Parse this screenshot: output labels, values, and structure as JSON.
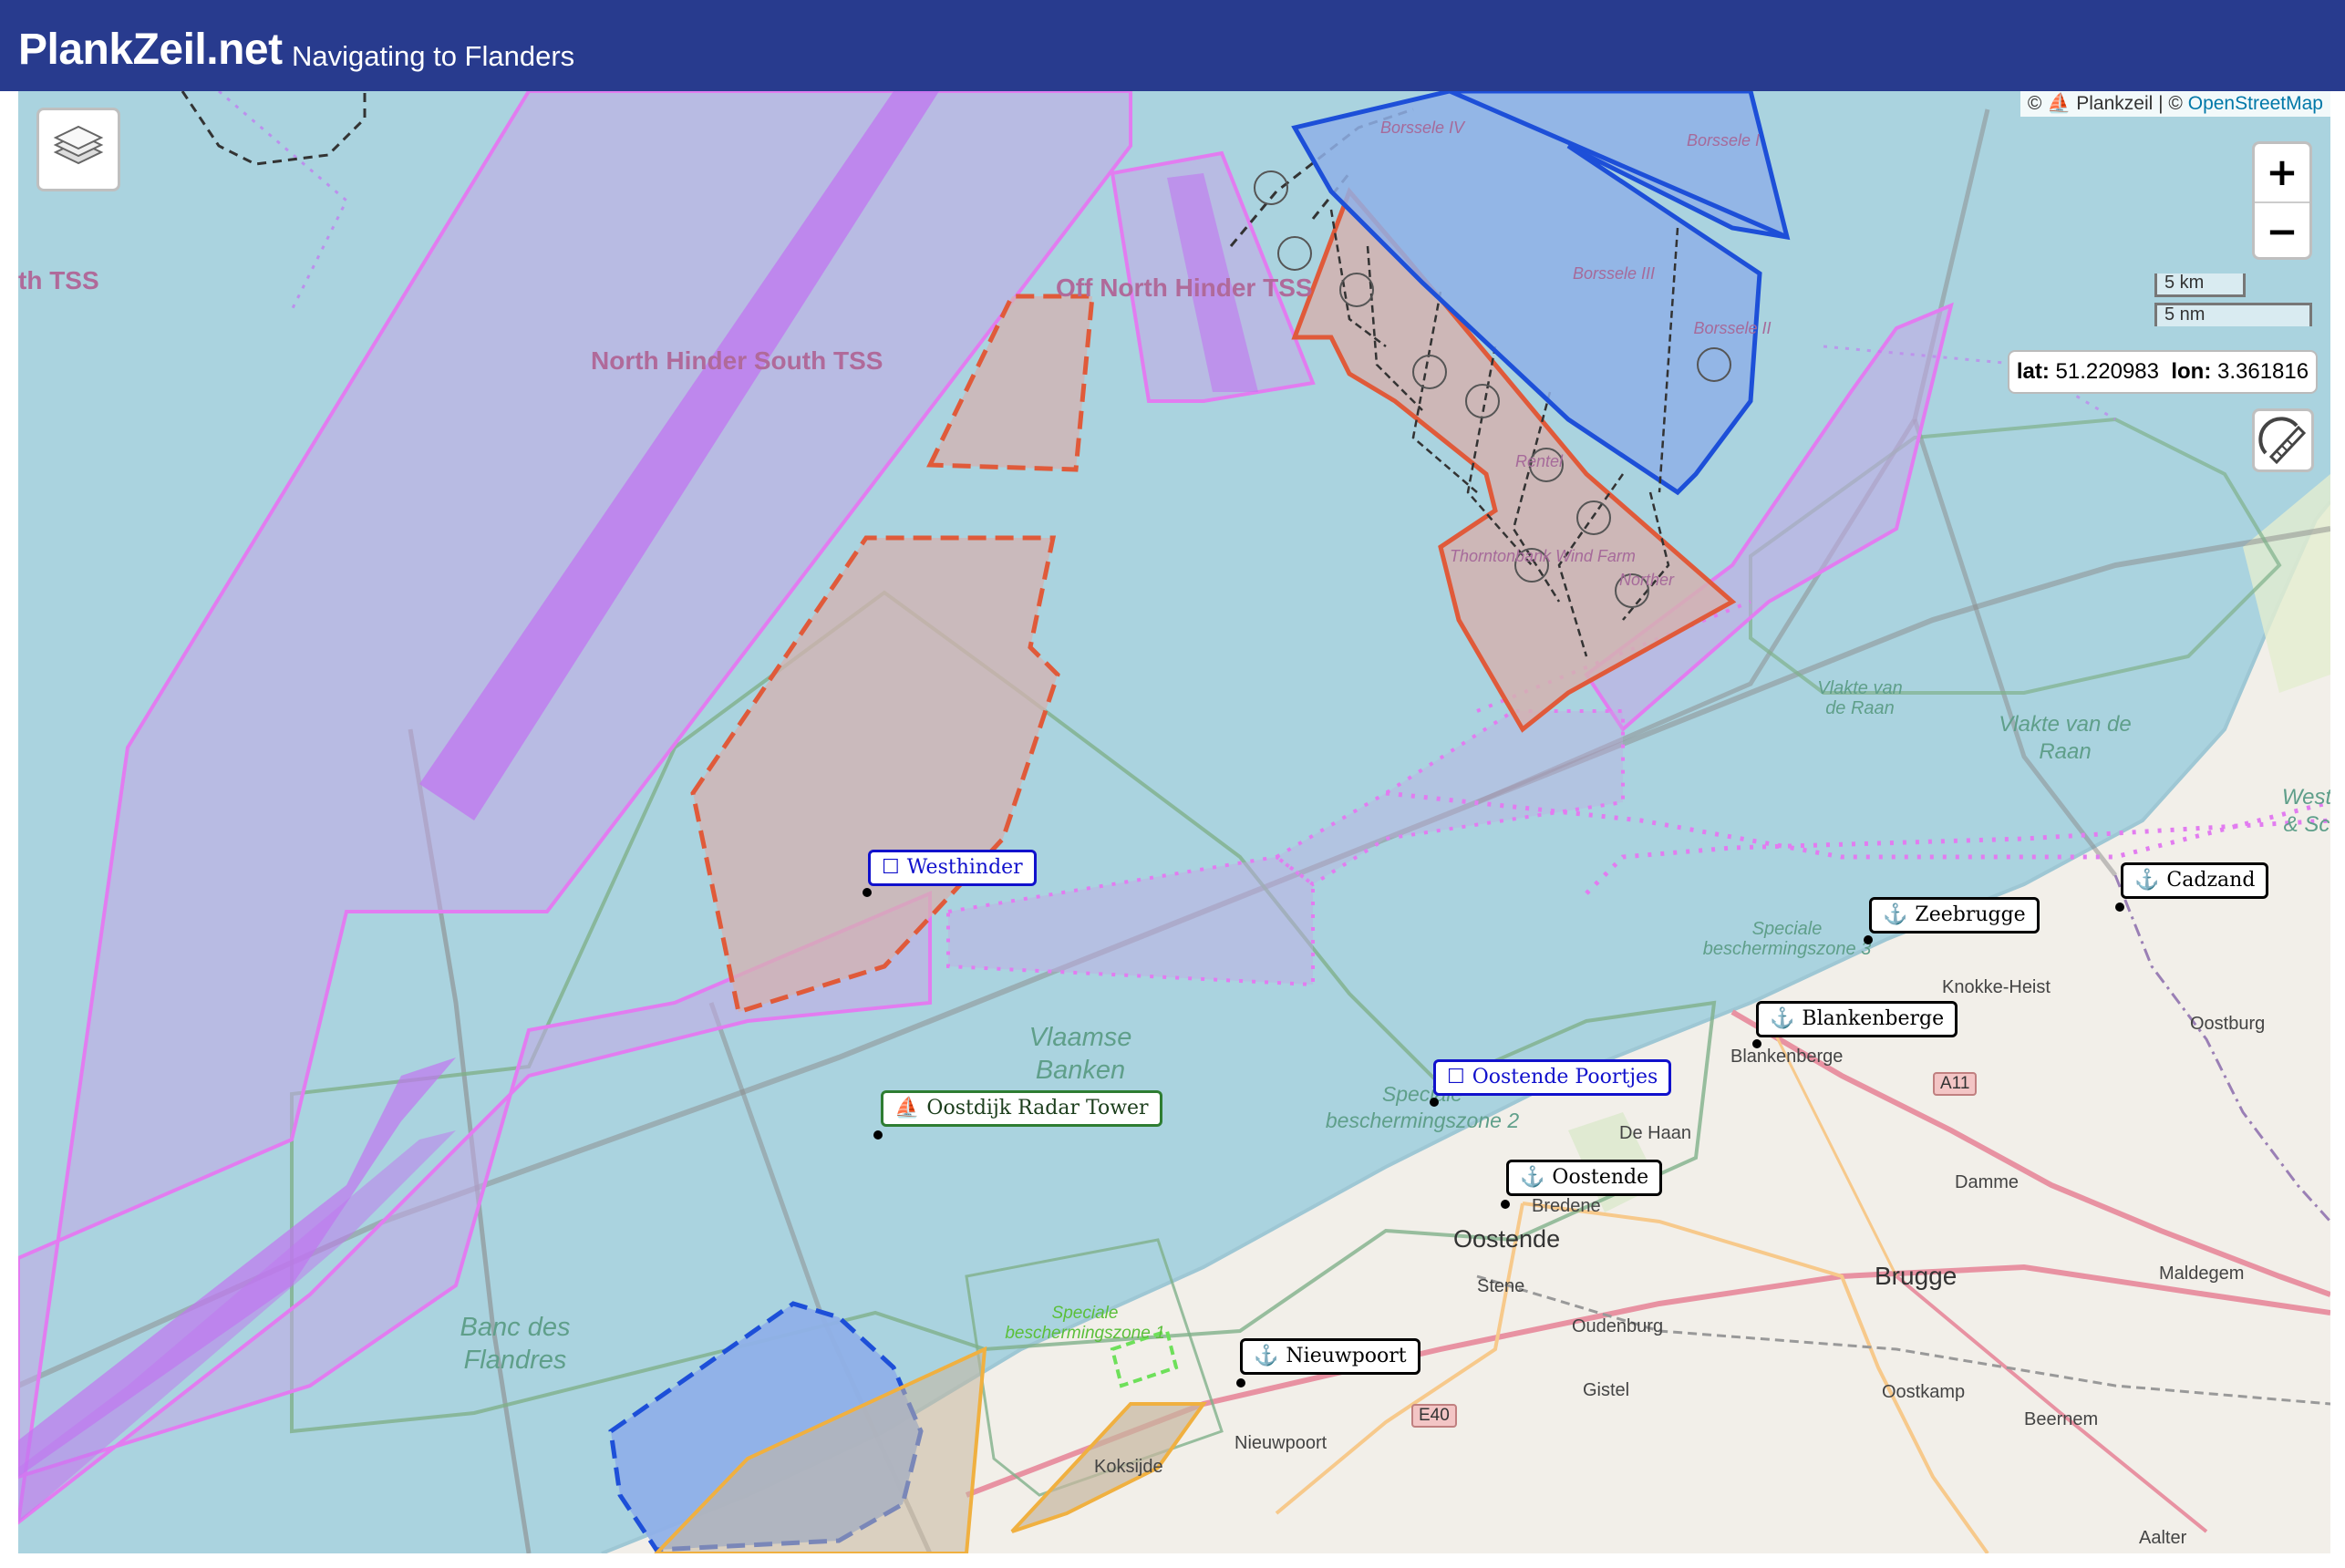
{
  "header": {
    "title": "PlankZeil.net",
    "subtitle": "Navigating to Flanders",
    "background": "#283b8e"
  },
  "map": {
    "attribution": {
      "prefix": "©",
      "plankzeil": "Plankzeil",
      "separator": "| ©",
      "osm": "OpenStreetMap"
    },
    "controls": {
      "zoom_in": "+",
      "zoom_out": "−",
      "layers_icon": "layers-icon",
      "draw_icon": "ruler-pencil-icon"
    },
    "scale": {
      "km": "5 km",
      "nm": "5 nm"
    },
    "cursor": {
      "lat_label": "lat:",
      "lat": "51.220983",
      "lon_label": "lon:",
      "lon": "3.361816"
    },
    "zones": {
      "tss_partial": "th TSS",
      "north_hinder_south": "North Hinder South TSS",
      "off_north_hinder": "Off North Hinder TSS"
    },
    "wind_farms": {
      "borssele_iv": "Borssele IV",
      "borssele_i": "Borssele I",
      "borssele_iii": "Borssele III",
      "borssele_ii": "Borssele II",
      "rentel": "Rentel",
      "thorntonbank": "Thorntonbank Wind Farm",
      "northen": "Norther"
    },
    "sea_areas": {
      "vlakte_small": "Vlakte van de Raan",
      "vlakte_big": "Vlakte van de Raan",
      "vlaamse_banken": "Vlaamse Banken",
      "banc_des_flandres": "Banc des Flandres",
      "west_partial": "West & Sc",
      "szone3": "Speciale beschermingszone 3",
      "szone2": "Speciale beschermingszone 2",
      "szone1": "Speciale beschermingszone 1"
    },
    "markers": [
      {
        "label": "Westhinder",
        "kind": "buoy",
        "style": "blue",
        "icon": "square-icon"
      },
      {
        "label": "Oostende Poortjes",
        "kind": "buoy",
        "style": "blue",
        "icon": "square-icon"
      },
      {
        "label": "Oostdijk Radar Tower",
        "kind": "tower",
        "style": "green",
        "icon": "boat-icon"
      },
      {
        "label": "Zeebrugge",
        "kind": "harbour",
        "style": "black",
        "icon": "anchor-icon"
      },
      {
        "label": "Cadzand",
        "kind": "harbour",
        "style": "black",
        "icon": "anchor-icon"
      },
      {
        "label": "Blankenberge",
        "kind": "harbour",
        "style": "black",
        "icon": "anchor-icon"
      },
      {
        "label": "Oostende",
        "kind": "harbour",
        "style": "black",
        "icon": "anchor-icon"
      },
      {
        "label": "Nieuwpoort",
        "kind": "harbour",
        "style": "black",
        "icon": "anchor-icon"
      }
    ],
    "towns": {
      "knokke": "Knokke-Heist",
      "oostburg": "Oostburg",
      "blankenberge": "Blankenberge",
      "de_haan": "De Haan",
      "damme": "Damme",
      "bredene": "Bredene",
      "oostende": "Oostende",
      "stene": "Stene",
      "brugge": "Brugge",
      "maldegem": "Maldegem",
      "oudenburg": "Oudenburg",
      "gistel": "Gistel",
      "oostkamp": "Oostkamp",
      "beernem": "Beernem",
      "nieuwpoort": "Nieuwpoort",
      "koksijde": "Koksijde",
      "aalter": "Aalter"
    },
    "roads": {
      "a11": "A11",
      "e40": "E40"
    },
    "colors": {
      "sea": "#aad3df",
      "land": "#f2efe9",
      "tss": "#e27cf0",
      "tss_fill": "#c3a8e6",
      "windfarm_outline": "#e05a3a",
      "borssele_blue": "#1d4fd8",
      "nature_green": "#7fb08a"
    }
  }
}
